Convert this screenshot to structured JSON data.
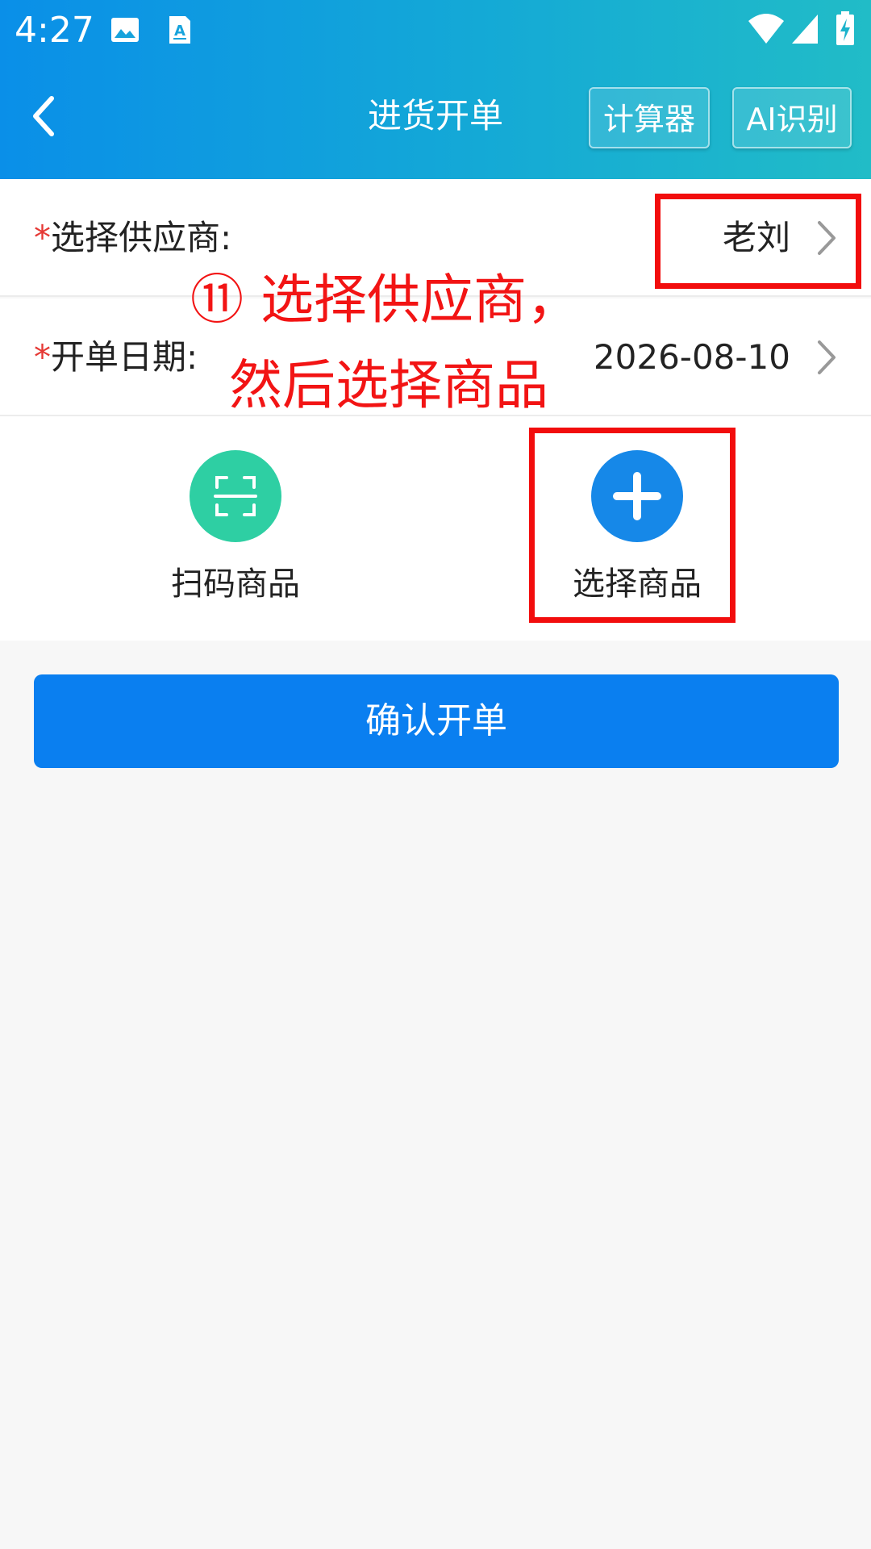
{
  "status_bar": {
    "time": "4:27",
    "left_icons": [
      "image-icon",
      "text-recognition-icon"
    ],
    "right_icons": [
      "wifi-icon",
      "cellular-signal-icon",
      "battery-charging-icon"
    ]
  },
  "header": {
    "title": "进货开单",
    "back_icon": "chevron-left-icon",
    "calculator_label": "计算器",
    "ai_label": "AI识别"
  },
  "form": {
    "supplier": {
      "required_mark": "*",
      "label": "选择供应商:",
      "value": "老刘"
    },
    "date": {
      "required_mark": "*",
      "label": "开单日期:",
      "value": "2026-08-10"
    }
  },
  "actions": {
    "scan": {
      "label": "扫码商品",
      "icon": "scan-frame-icon",
      "color": "#2ecfa3"
    },
    "select": {
      "label": "选择商品",
      "icon": "plus-icon",
      "color": "#1688e8"
    }
  },
  "confirm_label": "确认开单",
  "annotation": {
    "line1": "⑪ 选择供应商，",
    "line2": "然后选择商品",
    "color": "#f20d0d"
  }
}
